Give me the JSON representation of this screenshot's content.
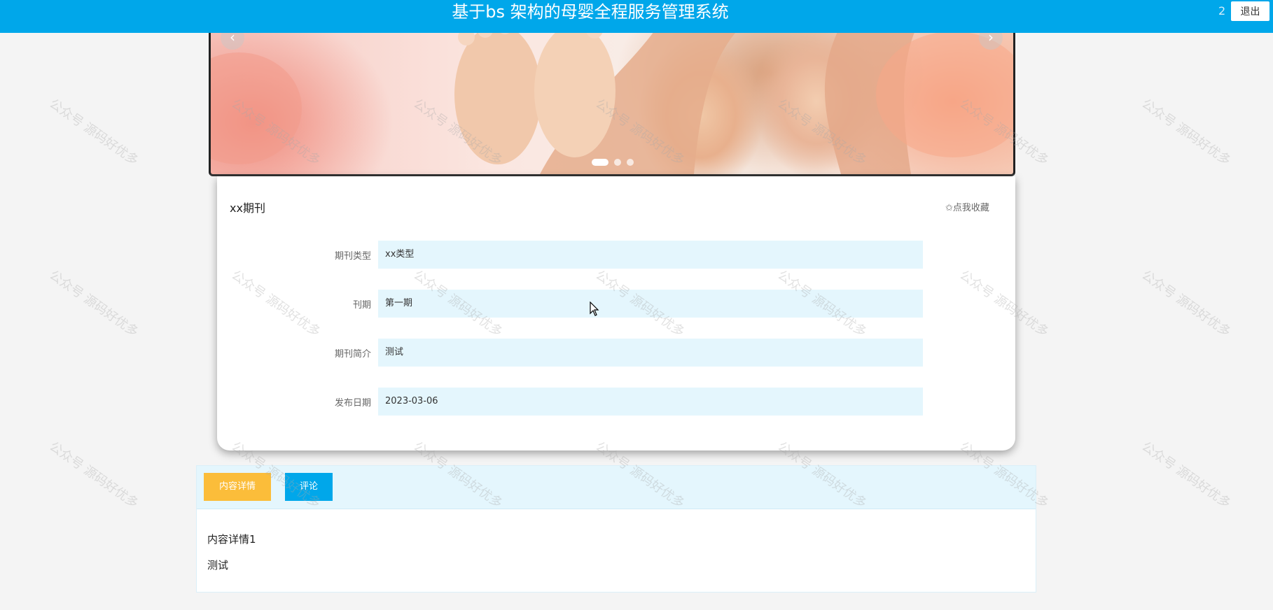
{
  "header": {
    "title": "基于bs 架构的母婴全程服务管理系统",
    "user_id": "2",
    "logout_label": "退出"
  },
  "banner": {
    "prev_icon": "‹",
    "next_icon": "›",
    "slide_count": 3,
    "active_slide": 1
  },
  "detail": {
    "title": "xx期刊",
    "favorite_label": "✩点我收藏",
    "fields": [
      {
        "label": "期刊类型",
        "value": "xx类型"
      },
      {
        "label": "刊期",
        "value": "第一期"
      },
      {
        "label": "期刊简介",
        "value": "测试"
      },
      {
        "label": "发布日期",
        "value": "2023-03-06"
      }
    ]
  },
  "tabs": {
    "items": [
      {
        "label": "内容详情",
        "active": true
      },
      {
        "label": "评论",
        "active": false
      }
    ],
    "content_lines": [
      "内容详情1",
      "测试"
    ]
  },
  "watermark": "公众号 源码好优多",
  "colors": {
    "primary": "#00a7ea",
    "tab_active": "#fbbd3a",
    "field_bg": "#e4f6fd",
    "page_bg": "#f4f4f4"
  }
}
